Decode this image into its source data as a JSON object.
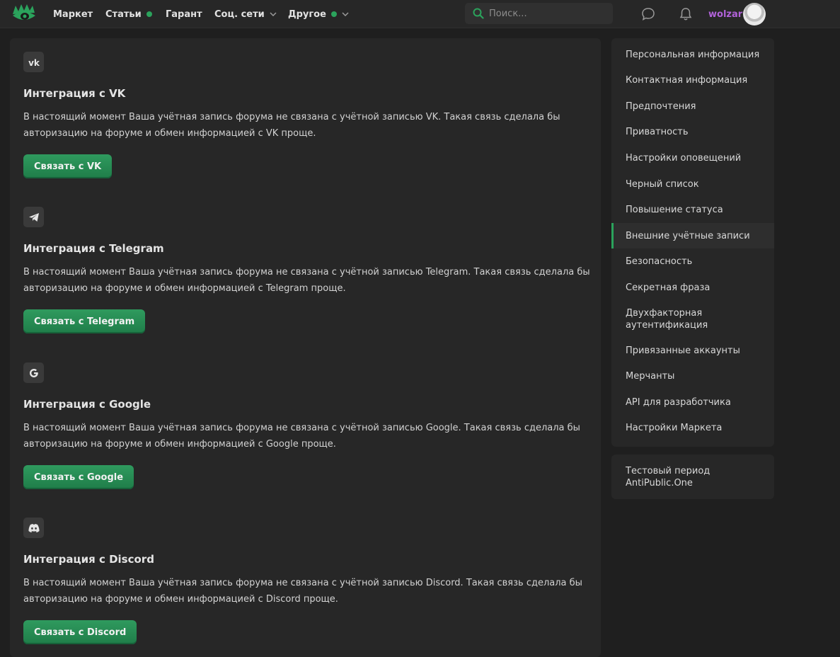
{
  "nav": {
    "items": [
      {
        "label": "Маркет"
      },
      {
        "label": "Статьи"
      },
      {
        "label": "Гарант"
      },
      {
        "label": "Соц. сети"
      },
      {
        "label": "Другое"
      }
    ],
    "search_placeholder": "Поиск...",
    "username": "wolzar",
    "accent_color": "#2ba35c",
    "username_color": "#b162d9"
  },
  "integrations": [
    {
      "icon": "vk-icon",
      "title": "Интеграция с VK",
      "description": "В настоящий момент Ваша учётная запись форума не связана с учётной записью VK. Такая связь сделала бы авторизацию на форуме и обмен информацией с VK проще.",
      "button": "Связать с VK"
    },
    {
      "icon": "telegram-icon",
      "title": "Интеграция с Telegram",
      "description": "В настоящий момент Ваша учётная запись форума не связана с учётной записью Telegram. Такая связь сделала бы авторизацию на форуме и обмен информацией с Telegram проще.",
      "button": "Связать с Telegram"
    },
    {
      "icon": "google-icon",
      "title": "Интеграция с Google",
      "description": "В настоящий момент Ваша учётная запись форума не связана с учётной записью Google. Такая связь сделала бы авторизацию на форуме и обмен информацией с Google проще.",
      "button": "Связать с Google"
    },
    {
      "icon": "discord-icon",
      "title": "Интеграция с Discord",
      "description": "В настоящий момент Ваша учётная запись форума не связана с учётной записью Discord. Такая связь сделала бы авторизацию на форуме и обмен информацией с Discord проще.",
      "button": "Связать с Discord"
    }
  ],
  "sidebar": {
    "items": [
      {
        "label": "Персональная информация"
      },
      {
        "label": "Контактная информация"
      },
      {
        "label": "Предпочтения"
      },
      {
        "label": "Приватность"
      },
      {
        "label": "Настройки оповещений"
      },
      {
        "label": "Черный список"
      },
      {
        "label": "Повышение статуса"
      },
      {
        "label": "Внешние учётные записи",
        "active": true
      },
      {
        "label": "Безопасность"
      },
      {
        "label": "Секретная фраза"
      },
      {
        "label": "Двухфакторная аутентификация"
      },
      {
        "label": "Привязанные аккаунты"
      },
      {
        "label": "Мерчанты"
      },
      {
        "label": "API для разработчика"
      },
      {
        "label": "Настройки Маркета"
      }
    ],
    "extra": "Тестовый период AntiPublic.One"
  }
}
